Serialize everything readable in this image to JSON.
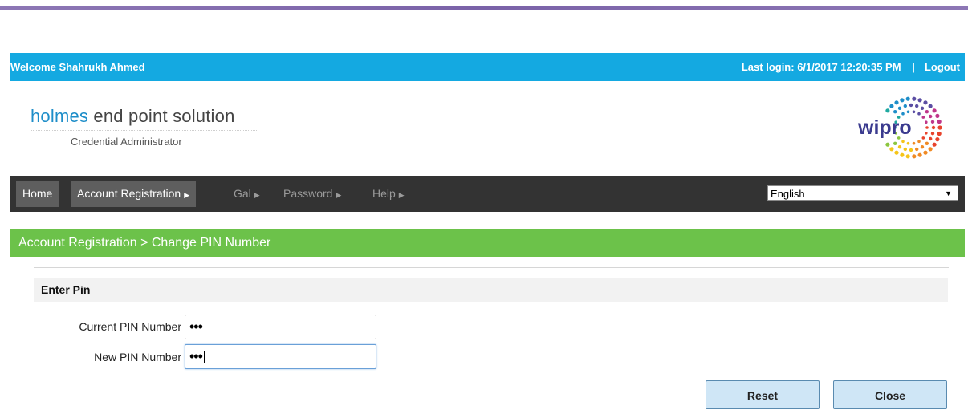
{
  "header": {
    "welcome": "Welcome Shahrukh Ahmed",
    "last_login": "Last login: 6/1/2017 12:20:35 PM",
    "separator": "|",
    "logout": "Logout"
  },
  "brand": {
    "holmes": "holmes",
    "product": " end point solution",
    "subtitle": "Credential Administrator",
    "logo_text": "wipro"
  },
  "nav": {
    "items": [
      {
        "label": "Home"
      },
      {
        "label": "Account Registration"
      },
      {
        "label": "Gal"
      },
      {
        "label": "Password"
      },
      {
        "label": "Help"
      }
    ],
    "language": "English"
  },
  "breadcrumb": "Account Registration > Change PIN Number",
  "form": {
    "section_title": "Enter Pin",
    "current_pin_label": "Current PIN Number",
    "current_pin_value": "•••",
    "new_pin_label": "New PIN Number",
    "new_pin_value": "•••"
  },
  "buttons": {
    "reset": "Reset",
    "close": "Close"
  },
  "colors": {
    "welcome_bar": "#14a9e1",
    "navbar": "#333333",
    "breadcrumb_bar": "#6cc24a",
    "button": "#cfe6f6"
  }
}
